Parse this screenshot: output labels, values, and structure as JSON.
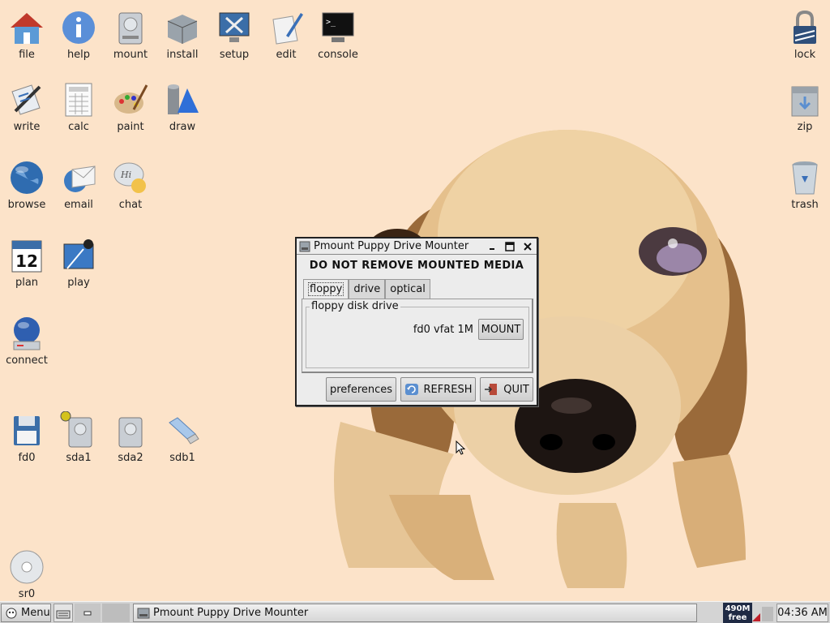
{
  "desktop": {
    "icons": {
      "file": "file",
      "help": "help",
      "mount": "mount",
      "install": "install",
      "setup": "setup",
      "edit": "edit",
      "console": "console",
      "lock": "lock",
      "write": "write",
      "calc": "calc",
      "paint": "paint",
      "draw": "draw",
      "zip": "zip",
      "browse": "browse",
      "email": "email",
      "chat": "chat",
      "trash": "trash",
      "plan": "plan",
      "plan_day": "12",
      "play": "play",
      "connect": "connect",
      "fd0": "fd0",
      "sda1": "sda1",
      "sda2": "sda2",
      "sdb1": "sdb1",
      "sr0": "sr0"
    }
  },
  "window": {
    "title": "Pmount Puppy Drive Mounter",
    "warning": "DO NOT REMOVE MOUNTED MEDIA",
    "tabs": [
      "floppy",
      "drive",
      "optical"
    ],
    "group_label": "floppy disk drive",
    "device_info": "fd0 vfat 1M",
    "mount_label": "MOUNT",
    "preferences_label": "preferences",
    "refresh_label": "REFRESH",
    "quit_label": "QUIT"
  },
  "taskbar": {
    "menu_label": "Menu",
    "task_title": "Pmount Puppy Drive Mounter",
    "free_value": "490M",
    "free_label": "free",
    "clock": "04:36 AM"
  }
}
